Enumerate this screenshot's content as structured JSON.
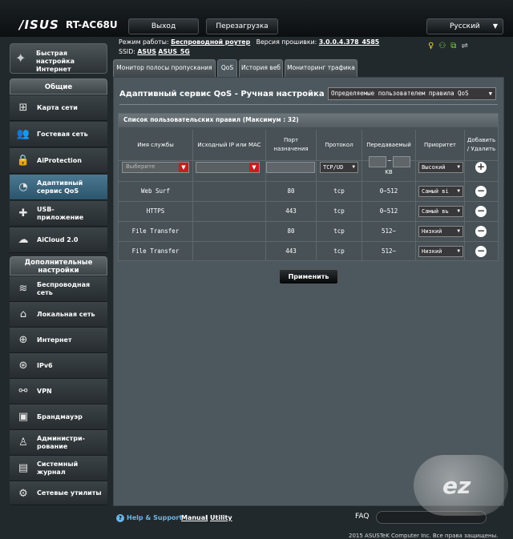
{
  "header": {
    "brand": "/ISUS",
    "model": "RT-AC68U",
    "logout": "Выход",
    "reboot": "Перезагрузка",
    "language": "Русский"
  },
  "info": {
    "mode_label": "Режим работы:",
    "mode_value": "Беспроводной роутер",
    "fw_label": "Версия прошивки:",
    "fw_value": "3.0.0.4.378_4585",
    "ssid_label": "SSID:",
    "ssid1": "ASUS",
    "ssid2": "ASUS_5G"
  },
  "sidebar": {
    "qis": "Быстрая настройка Интернет",
    "general_title": "Общие",
    "general": [
      {
        "label": "Карта сети",
        "icon": "network-map-icon"
      },
      {
        "label": "Гостевая сеть",
        "icon": "guest-network-icon"
      },
      {
        "label": "AiProtection",
        "icon": "lock-icon"
      },
      {
        "label": "Адаптивный сервис QoS",
        "icon": "speedometer-icon"
      },
      {
        "label": "USB-приложение",
        "icon": "puzzle-icon"
      },
      {
        "label": "AiCloud 2.0",
        "icon": "cloud-icon"
      }
    ],
    "advanced_title": "Дополнительные настройки",
    "advanced": [
      {
        "label": "Беспроводная сеть",
        "icon": "wifi-icon"
      },
      {
        "label": "Локальная сеть",
        "icon": "home-icon"
      },
      {
        "label": "Интернет",
        "icon": "globe-icon"
      },
      {
        "label": "IPv6",
        "icon": "ipv6-globe-icon"
      },
      {
        "label": "VPN",
        "icon": "vpn-icon"
      },
      {
        "label": "Брандмауэр",
        "icon": "firewall-icon"
      },
      {
        "label": "Администри-рование",
        "icon": "admin-user-icon"
      },
      {
        "label": "Системный журнал",
        "icon": "log-icon"
      },
      {
        "label": "Сетевые утилиты",
        "icon": "tools-icon"
      }
    ]
  },
  "tabs": [
    "Монитор полосы пропускания",
    "QoS",
    "История веб",
    "Мониторинг трафика"
  ],
  "page": {
    "title": "Адаптивный сервис QoS - Ручная настройка",
    "mode_select": "Определяемые пользователем правила QoS",
    "table_title": "Список пользовательских правил (Максимум : 32)",
    "columns": [
      "Имя службы",
      "Исходный IP или MAC",
      "Порт назначения",
      "Протокол",
      "Передаваемый",
      "Приоритет",
      "Добавить / Удалить"
    ],
    "new_rule": {
      "service_placeholder": "Выберите",
      "protocol": "TCP/UD",
      "range_sep": "~",
      "unit": "KB",
      "priority": "Высокий"
    },
    "rules": [
      {
        "service": "Web Surf",
        "source": "",
        "port": "80",
        "protocol": "tcp",
        "transferred": "0~512",
        "priority": "Самый ві"
      },
      {
        "service": "HTTPS",
        "source": "",
        "port": "443",
        "protocol": "tcp",
        "transferred": "0~512",
        "priority": "Самый вь"
      },
      {
        "service": "File Transfer",
        "source": "",
        "port": "80",
        "protocol": "tcp",
        "transferred": "512~",
        "priority": "Низкий"
      },
      {
        "service": "File Transfer",
        "source": "",
        "port": "443",
        "protocol": "tcp",
        "transferred": "512~",
        "priority": "Низкий"
      }
    ],
    "apply": "Применить"
  },
  "footer": {
    "help": "Help & Support",
    "manual": "Manual",
    "sep": "|",
    "utility": "Utility",
    "faq": "FAQ",
    "copyright": "2015 ASUSTeK Computer Inc. Все права защищены."
  }
}
